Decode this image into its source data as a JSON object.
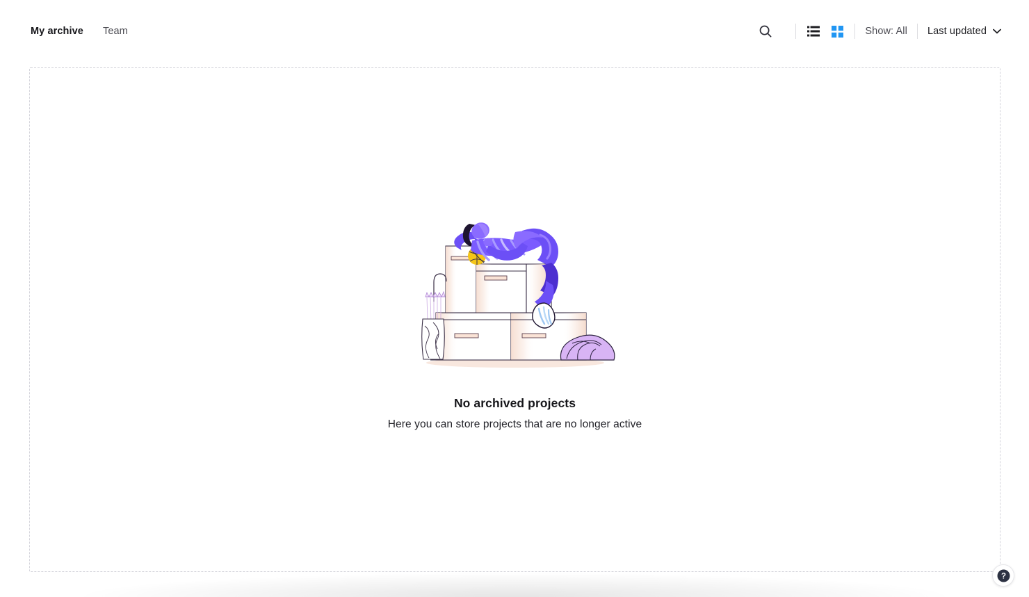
{
  "header": {
    "tabs": [
      {
        "label": "My archive",
        "active": true
      },
      {
        "label": "Team",
        "active": false
      }
    ],
    "search_icon": "search-icon",
    "view_list_icon": "list-view-icon",
    "view_grid_icon": "grid-view-icon",
    "active_view": "grid",
    "show_filter_label": "Show: All",
    "sort_label": "Last updated",
    "sort_chevron_icon": "chevron-down-icon"
  },
  "empty_state": {
    "illustration_name": "archive-boxes-illustration",
    "title": "No archived projects",
    "subtitle": "Here you can store projects that are no longer active"
  },
  "help": {
    "icon": "question-mark-icon",
    "label": "?"
  },
  "colors": {
    "accent_blue": "#2196f3",
    "illustration_purple": "#6c4ff6",
    "illustration_purple_dark": "#4c2fd0",
    "illustration_purple_light": "#8a6bff",
    "illustration_lilac": "#c9a8f0",
    "illustration_peach": "#f6ddd0",
    "illustration_yellow": "#f5c518",
    "text_primary": "#16161a",
    "text_secondary": "#4b4b52",
    "dashed_border": "#d3d3da"
  }
}
